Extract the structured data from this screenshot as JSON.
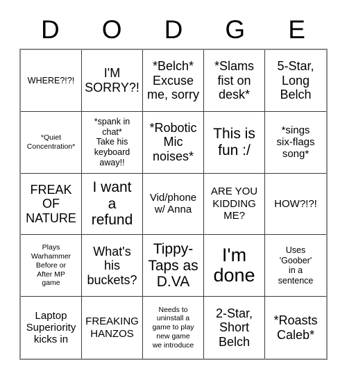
{
  "header": {
    "letters": [
      "D",
      "O",
      "D",
      "G",
      "E"
    ]
  },
  "grid": {
    "columns": 5,
    "rows": 5,
    "cells": [
      {
        "text": "WHERE?!?!",
        "size": "fs-s"
      },
      {
        "text": "I'M\nSORRY?!",
        "size": "fs-l"
      },
      {
        "text": "*Belch*\nExcuse\nme, sorry",
        "size": "fs-l"
      },
      {
        "text": "*Slams\nfist on\ndesk*",
        "size": "fs-l"
      },
      {
        "text": "5-Star,\nLong\nBelch",
        "size": "fs-l"
      },
      {
        "text": "*Quiet\nConcentration*",
        "size": "fs-xs"
      },
      {
        "text": "*spank in\nchat*\nTake his\nkeyboard\naway!!",
        "size": "fs-s"
      },
      {
        "text": "*Robotic\nMic\nnoises*",
        "size": "fs-l"
      },
      {
        "text": "This is\nfun :/",
        "size": "fs-xl"
      },
      {
        "text": "*sings\nsix-flags\nsong*",
        "size": "fs-m"
      },
      {
        "text": "FREAK\nOF\nNATURE",
        "size": "fs-l"
      },
      {
        "text": "I want\na\nrefund",
        "size": "fs-xl"
      },
      {
        "text": "Vid/phone\nw/ Anna",
        "size": "fs-m"
      },
      {
        "text": "ARE YOU\nKIDDING\nME?",
        "size": "fs-m"
      },
      {
        "text": "HOW?!?!",
        "size": "fs-m"
      },
      {
        "text": "Plays\nWarhammer\nBefore or\nAfter MP\ngame",
        "size": "fs-xs"
      },
      {
        "text": "What's\nhis\nbuckets?",
        "size": "fs-l"
      },
      {
        "text": "Tippy-\nTaps as\nD.VA",
        "size": "fs-xl"
      },
      {
        "text": "I'm\ndone",
        "size": "fs-xxl"
      },
      {
        "text": "Uses\n'Goober'\nin a\nsentence",
        "size": "fs-s"
      },
      {
        "text": "Laptop\nSuperiority\nkicks in",
        "size": "fs-m"
      },
      {
        "text": "FREAKING\nHANZOS",
        "size": "fs-m"
      },
      {
        "text": "Needs to\nuninstall a\ngame to play\nnew game\nwe introduce",
        "size": "fs-xs"
      },
      {
        "text": "2-Star,\nShort\nBelch",
        "size": "fs-l"
      },
      {
        "text": "*Roasts\nCaleb*",
        "size": "fs-l"
      }
    ]
  },
  "colors": {
    "background": "#ffffff",
    "text": "#000000",
    "grid_line": "#3a3a3a",
    "grid_outer": "#8a8a8a"
  }
}
